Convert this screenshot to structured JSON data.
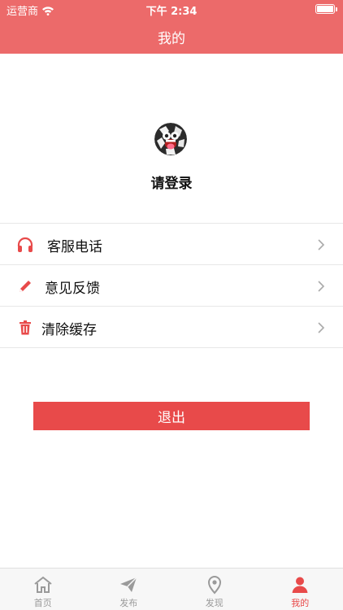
{
  "status_bar": {
    "carrier": "运营商",
    "time": "下午 2:34"
  },
  "header": {
    "title": "我的"
  },
  "profile": {
    "login_text": "请登录"
  },
  "menu": [
    {
      "label": "客服电话",
      "icon": "headphones-icon"
    },
    {
      "label": "意见反馈",
      "icon": "pencil-icon"
    },
    {
      "label": "清除缓存",
      "icon": "trash-icon"
    }
  ],
  "logout_button": {
    "label": "退出"
  },
  "tabbar": [
    {
      "label": "首页",
      "icon": "home-icon"
    },
    {
      "label": "发布",
      "icon": "send-icon"
    },
    {
      "label": "发现",
      "icon": "location-icon"
    },
    {
      "label": "我的",
      "icon": "person-icon",
      "active": true
    }
  ],
  "colors": {
    "header": "#ec6a6a",
    "accent": "#e84a4a",
    "tab_inactive": "#9a9a9a"
  }
}
